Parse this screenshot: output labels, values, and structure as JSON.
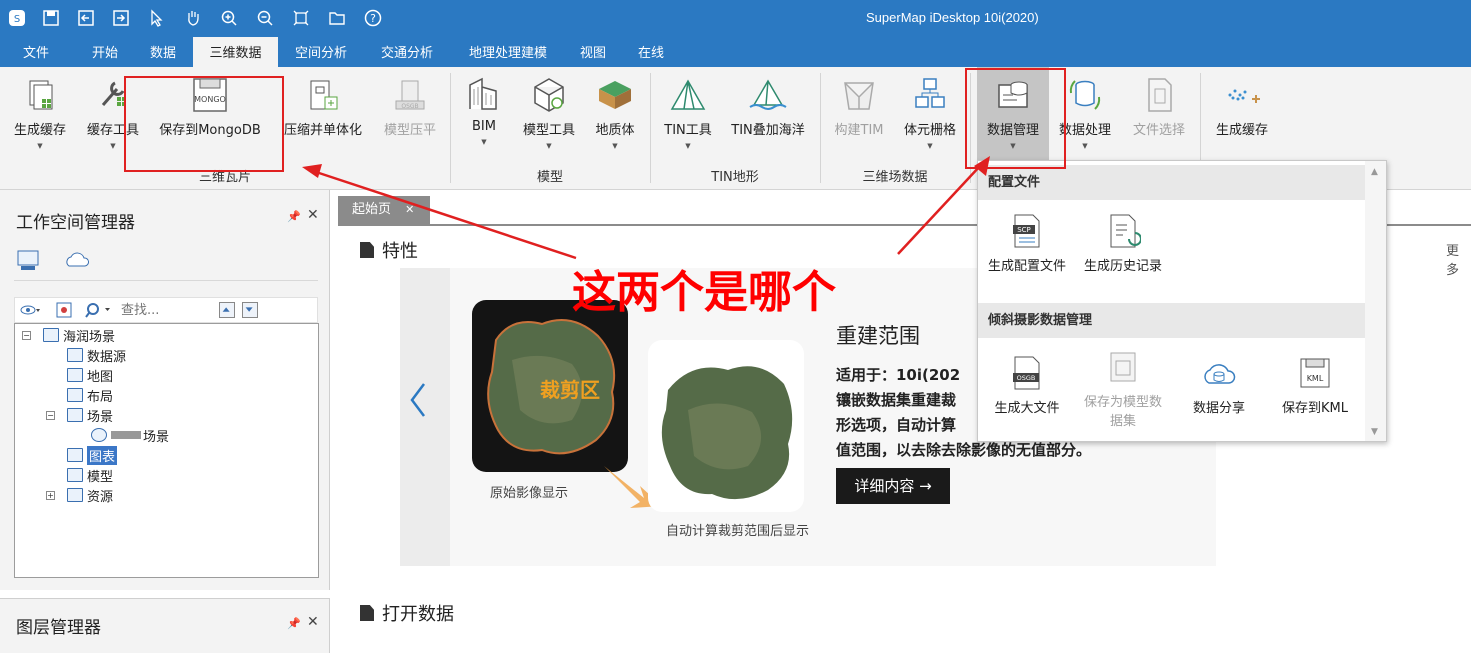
{
  "app": {
    "title": "SuperMap iDesktop 10i(2020)",
    "quick_access": [
      "logo-icon",
      "save-icon",
      "import-icon",
      "export-icon",
      "pointer-icon",
      "pan-hand-icon",
      "zoom-in-icon",
      "zoom-out-icon",
      "full-extent-icon",
      "open-folder-icon",
      "help-icon"
    ]
  },
  "menu": {
    "tabs": [
      "文件",
      "开始",
      "数据",
      "三维数据",
      "空间分析",
      "交通分析",
      "地理处理建模",
      "视图",
      "在线"
    ],
    "active": "三维数据"
  },
  "ribbon": {
    "groups": [
      {
        "label": "三维瓦片",
        "buttons": [
          "生成缓存",
          "缓存工具",
          "保存到MongoDB",
          "压缩并单体化",
          "模型压平"
        ]
      },
      {
        "label": "模型",
        "buttons": [
          "BIM",
          "模型工具",
          "地质体"
        ]
      },
      {
        "label": "TIN地形",
        "buttons": [
          "TIN工具",
          "TIN叠加海洋"
        ]
      },
      {
        "label": "三维场数据",
        "buttons": [
          "构建TIM",
          "体元栅格"
        ]
      },
      {
        "label": "",
        "buttons": [
          "数据管理",
          "数据处理",
          "文件选择",
          "生成缓存"
        ]
      }
    ]
  },
  "workspace": {
    "title": "工作空间管理器",
    "search_placeholder": "查找...",
    "tree": {
      "root": "海润场景",
      "datasource": "数据源",
      "map": "地图",
      "layout": "布局",
      "scene": "场景",
      "scene_child": "场景",
      "chart": "图表",
      "model": "模型",
      "resource": "资源"
    }
  },
  "layer_manager": {
    "title": "图层管理器"
  },
  "document": {
    "tab": "起始页",
    "more": "更多",
    "features_title": "特性",
    "open_data_title": "打开数据",
    "slide": {
      "heading": "重建范围",
      "applies": "适用于：10i(202",
      "desc1": "镶嵌数据集重建裁",
      "desc2": "形选项，自动计算",
      "desc3": "值范围，以去除去除影像的无值部分。",
      "button": "详细内容 →",
      "clip_label": "裁剪区",
      "caption_left": "原始影像显示",
      "caption_right": "自动计算裁剪范围后显示"
    }
  },
  "dropdown": {
    "section1": "配置文件",
    "items1": [
      "生成配置文件",
      "生成历史记录"
    ],
    "section2": "倾斜摄影数据管理",
    "items2": [
      "生成大文件",
      "保存为模型数据集",
      "数据分享",
      "保存到KML"
    ]
  },
  "annotation": {
    "text": "这两个是哪个",
    "color": "#ff0000"
  }
}
